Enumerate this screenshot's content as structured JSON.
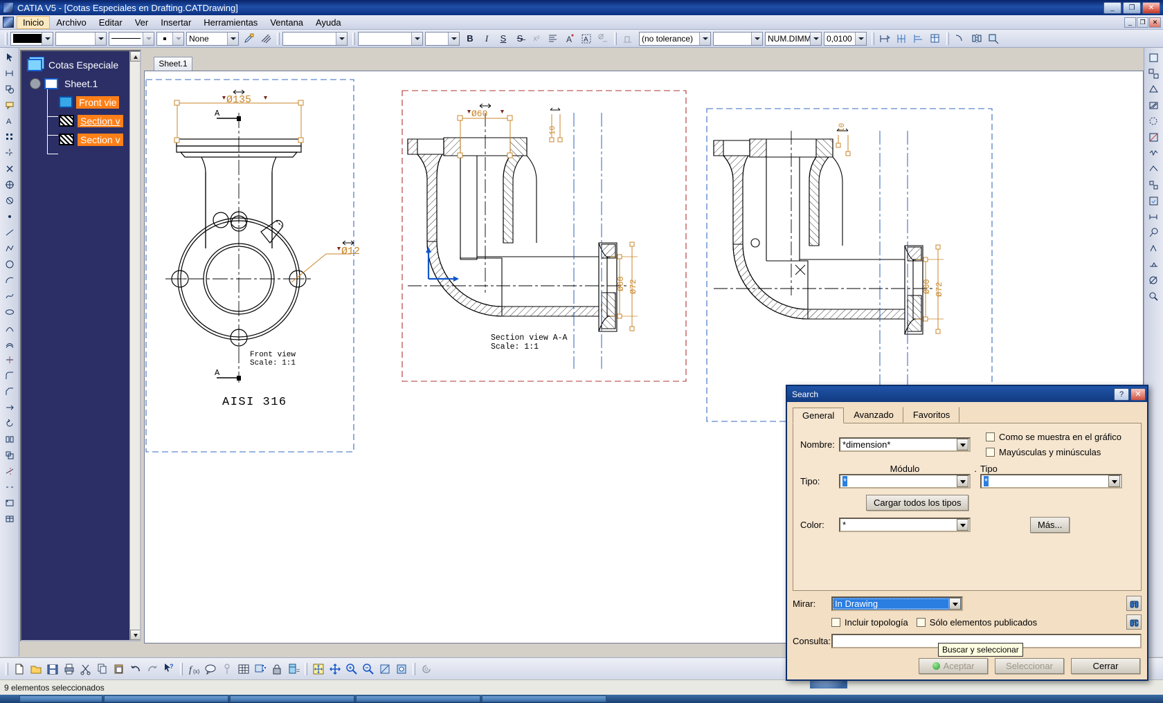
{
  "window": {
    "app_title": "CATIA V5 - [Cotas Especiales en Drafting.CATDrawing]",
    "icon": "catia-logo-icon",
    "minimize": "_",
    "restore": "❐",
    "close": "✕",
    "mdi_minimize": "_",
    "mdi_restore": "❐",
    "mdi_close": "✕"
  },
  "menubar": {
    "icon": "catia-doc-icon",
    "items": [
      {
        "label": "Inicio",
        "active": true
      },
      {
        "label": "Archivo",
        "active": false
      },
      {
        "label": "Editar",
        "active": false
      },
      {
        "label": "Ver",
        "active": false
      },
      {
        "label": "Insertar",
        "active": false
      },
      {
        "label": "Herramientas",
        "active": false
      },
      {
        "label": "Ventana",
        "active": false
      },
      {
        "label": "Ayuda",
        "active": false
      }
    ]
  },
  "toolbar": {
    "color_swatch": "#000000",
    "color_value": "",
    "weight_value": "",
    "linetype_value": "",
    "point_value": "",
    "pattern_value": "None",
    "paint_icon": "paint-brush-icon",
    "hatch_icon": "hatch-pattern-icon",
    "font_value": "",
    "size_value": "",
    "style_value": "",
    "bold_label": "B",
    "italic_label": "I",
    "underline_label": "S",
    "strike_label": "S̶",
    "superscript_label": "x²",
    "align_icon": "align-left-icon",
    "anchor_icon": "text-anchor-icon",
    "frame_icon": "text-frame-icon",
    "gdt_icon": "gdt-symbol-icon",
    "datum_icon": "datum-feature-icon",
    "tolerance_value": "(no tolerance)",
    "tolerance2_value": "",
    "numdim_value": "NUM.DIMM",
    "precision_value": "0,0100",
    "dim_icon_1": "dimension-create-icon",
    "dim_icon_2": "dimension-chain-icon",
    "dim_icon_3": "dimension-stack-icon",
    "dim_icon_4": "dimension-table-icon",
    "geom_icon_1": "fillet-icon",
    "geom_icon_2": "mirror-icon",
    "geom_icon_3": "scale-icon"
  },
  "left_rail": {
    "icons": [
      "select-icon",
      "dimension-icon",
      "shapes-icon",
      "annotation-icon",
      "text-icon",
      "pattern-icon",
      "axis-icon",
      "cross-icon",
      "target-icon",
      "circle-cross-icon",
      "point-icon",
      "line-icon",
      "polyline-icon",
      "circle-icon",
      "arc-icon",
      "spline-icon",
      "ellipse-icon",
      "conic-icon",
      "offset-icon",
      "trim-icon",
      "corner-icon",
      "chamfer-icon",
      "translate-icon",
      "rotate-icon",
      "symmetry-icon",
      "scale-icon",
      "relimit-icon",
      "break-icon",
      "insert-frame-icon",
      "insert-table-icon"
    ]
  },
  "right_rail": {
    "icons": [
      "new-view-icon",
      "projection-icon",
      "auxiliary-view-icon",
      "section-view-icon",
      "detail-view-icon",
      "clipping-icon",
      "broken-view-icon",
      "unfold-icon",
      "exploded-icon",
      "view-wizard-icon",
      "dimension-gen-icon",
      "balloon-icon",
      "roughness-icon",
      "weld-icon",
      "datum-target-icon",
      "search-icon"
    ]
  },
  "spec_tree": {
    "nodes": [
      {
        "label": "Cotas Especiale",
        "icon": "drawing-doc-icon",
        "selected": false,
        "depth": 0
      },
      {
        "label": "Sheet.1",
        "icon": "sheet-icon",
        "selected": false,
        "depth": 1
      },
      {
        "label": "Front vie",
        "icon": "front-view-icon",
        "selected": true,
        "depth": 2
      },
      {
        "label": "Section v",
        "icon": "section-view-icon",
        "selected": true,
        "depth": 2
      },
      {
        "label": "Section v",
        "icon": "section-view-icon",
        "selected": true,
        "depth": 2
      }
    ]
  },
  "sheet": {
    "tab_label": "Sheet.1"
  },
  "drawing": {
    "material_note": "AISI 316",
    "front_view": {
      "title": "Front view",
      "scale": "Scale:  1:1",
      "dim_diameter_flange": "Ø135",
      "dim_hole": "Ø12",
      "section_letter_top": "A",
      "section_letter_bottom": "A"
    },
    "section_view_aa": {
      "title": "Section view A-A",
      "scale": "Scale:  1:1",
      "dim_bore": "Ø60",
      "dim_right_1": "Ø60",
      "dim_right_2": "Ø72",
      "dim_small_top": "10"
    },
    "section_view_right": {
      "dim_top": "10",
      "dim_right_1": "Ø60",
      "dim_right_2": "Ø72"
    }
  },
  "search_dialog": {
    "title": "Search",
    "help_btn": "?",
    "close_btn": "✕",
    "tabs": [
      {
        "label": "General",
        "active": true
      },
      {
        "label": "Avanzado",
        "active": false
      },
      {
        "label": "Favoritos",
        "active": false
      }
    ],
    "nombre_label": "Nombre:",
    "nombre_value": "*dimension*",
    "modulo_label": "Módulo",
    "modulo_dot": ".",
    "tipo_label": "Tipo:",
    "tipo_modulo_value": "*",
    "tipo_right_label": "Tipo",
    "tipo_right_value": "*",
    "cargar_btn": "Cargar todos los tipos",
    "color_label": "Color:",
    "color_value": "*",
    "mas_btn": "Más...",
    "check_grafico": "Como se muestra en el gráfico",
    "check_mayusculas": "Mayúsculas y minúsculas",
    "mirar_label": "Mirar:",
    "mirar_value": "In Drawing",
    "check_topologia": "Incluir topología",
    "check_publicados": "Sólo elementos publicados",
    "consulta_label": "Consulta:",
    "consulta_value": "",
    "binocular_icon_1": "binoculars-search-icon",
    "binocular_icon_2": "binoculars-select-icon",
    "btn_aceptar": "Aceptar",
    "btn_seleccionar": "Seleccionar",
    "btn_cerrar": "Cerrar"
  },
  "tooltip": {
    "text": "Buscar y seleccionar"
  },
  "bottom_toolbar": {
    "icons": [
      "new-file-icon",
      "open-folder-icon",
      "save-icon",
      "print-icon",
      "cut-scissors-icon",
      "copy-icon",
      "paste-icon",
      "undo-icon",
      "redo-icon",
      "what-is-this-icon",
      "formula-icon",
      "comment-icon",
      "measure-item-icon",
      "table-icon",
      "analyze-icon",
      "lock-icon",
      "catalog-icon",
      "fit-all-icon",
      "pan-icon",
      "zoom-in-icon",
      "zoom-out-icon",
      "normal-view-icon",
      "render-style-icon",
      "hide-show-icon",
      "swap-visible-icon"
    ]
  },
  "statusbar": {
    "message": "9 elementos seleccionados"
  },
  "colors": {
    "title_blue": "#123a80",
    "tree_bg": "#2b2f66",
    "selection_orange": "#ff7f18",
    "dimension_orange": "#c8862a",
    "dialog_beige": "#f6e6d0",
    "highlight_blue": "#2a7de1",
    "section_frame_red": "#b03030",
    "view_frame_blue": "#3468c0"
  }
}
